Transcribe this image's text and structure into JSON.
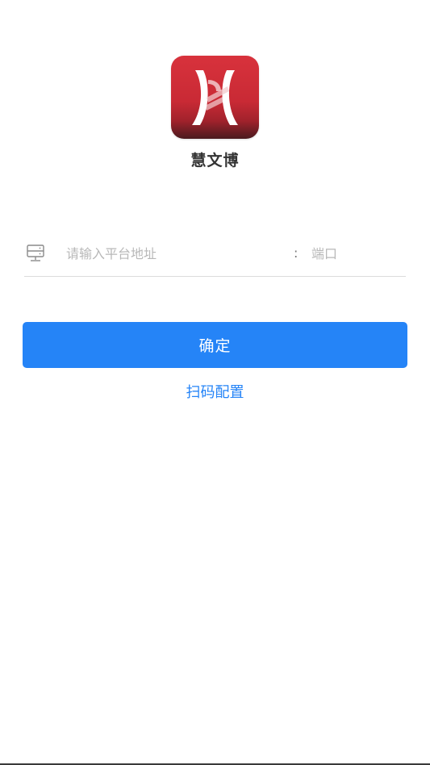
{
  "app": {
    "name": "慧文博",
    "logo_icon": "huiwenbo-logo-icon",
    "logo_color": "#d22f39"
  },
  "form": {
    "server_icon": "server-icon",
    "address_placeholder": "请输入平台地址",
    "address_value": "",
    "separator": ":",
    "port_placeholder": "端口",
    "port_value": ""
  },
  "actions": {
    "confirm_label": "确定",
    "scan_label": "扫码配置",
    "accent_color": "#2584f7"
  }
}
